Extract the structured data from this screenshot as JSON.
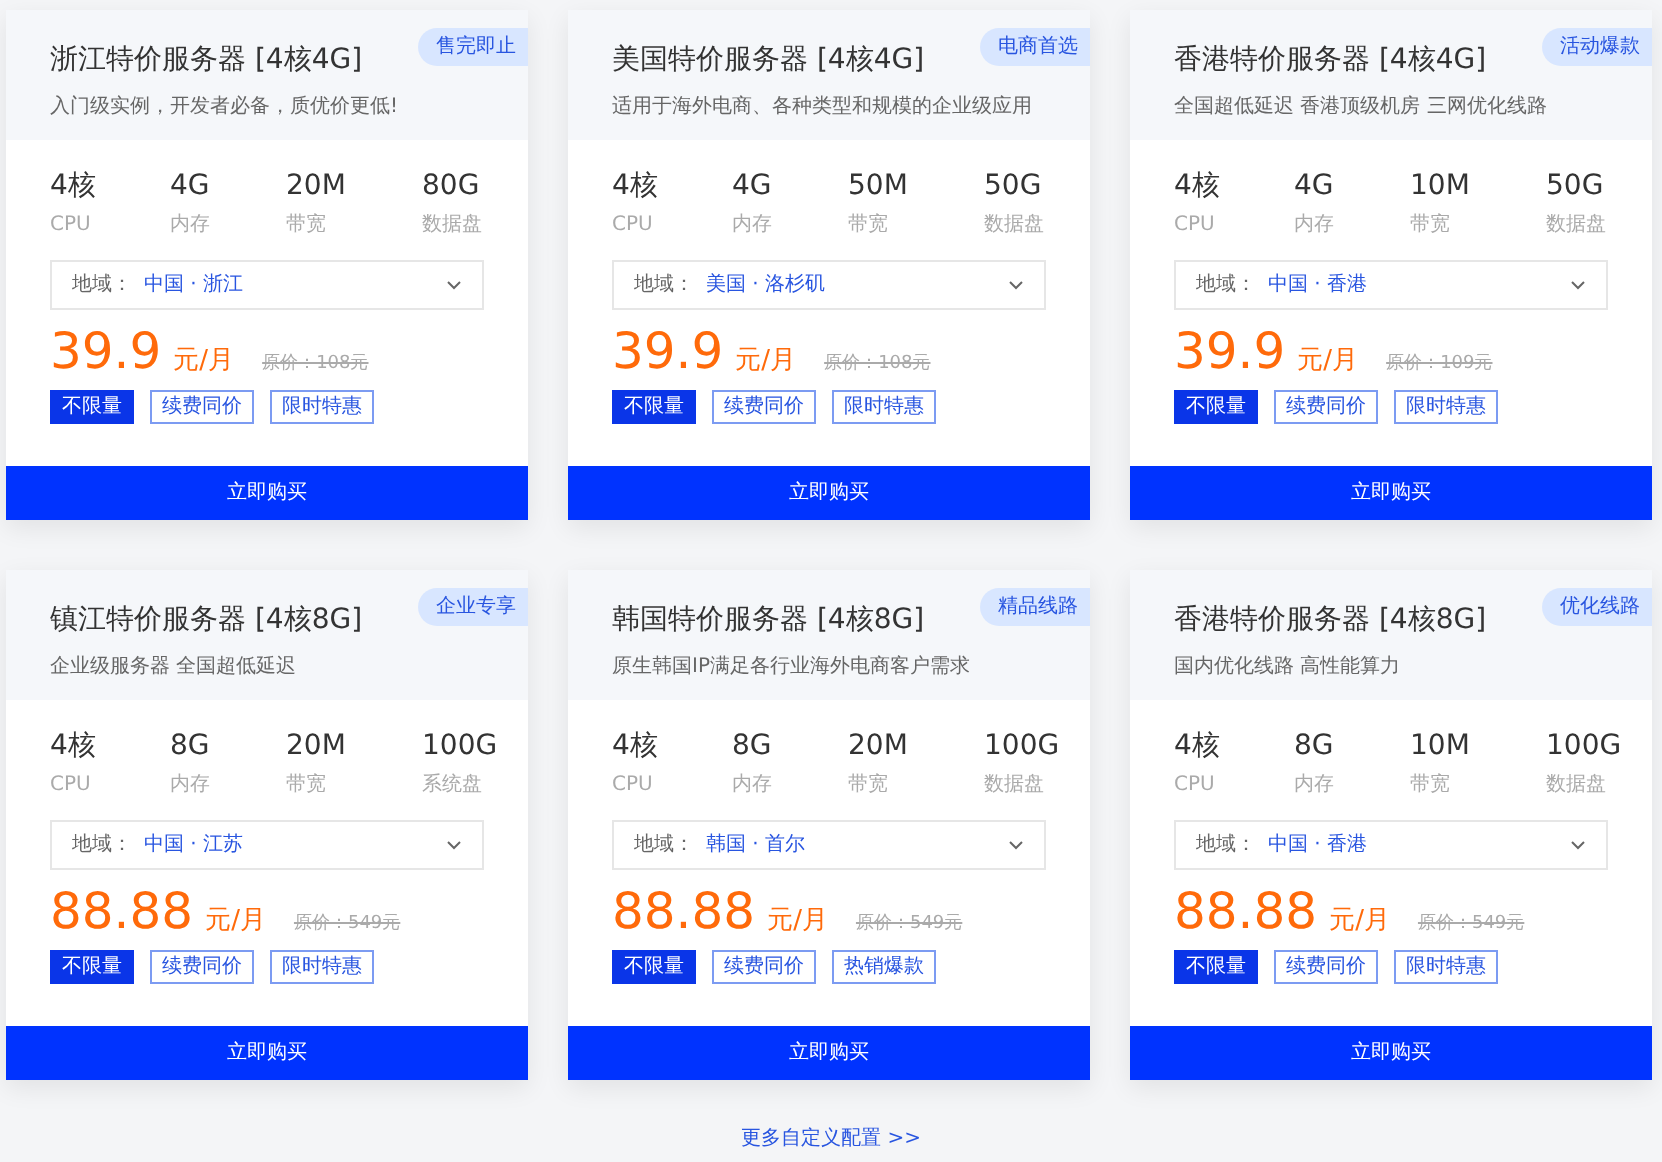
{
  "plans": [
    {
      "title": "浙江特价服务器 [4核4G]",
      "badge": "售完即止",
      "subtitle": "入门级实例，开发者必备，质优价更低!",
      "specs": [
        {
          "value": "4核",
          "label": "CPU"
        },
        {
          "value": "4G",
          "label": "内存"
        },
        {
          "value": "20M",
          "label": "带宽"
        },
        {
          "value": "80G",
          "label": "数据盘"
        }
      ],
      "region_label": "地域：",
      "region": "中国 · 浙江",
      "price": "39.9",
      "unit": "元/月",
      "original_price": "原价：108元",
      "tags": [
        {
          "text": "不限量",
          "kind": "solid"
        },
        {
          "text": "续费同价",
          "kind": "outline"
        },
        {
          "text": "限时特惠",
          "kind": "outline"
        }
      ],
      "button": "立即购买"
    },
    {
      "title": "美国特价服务器 [4核4G]",
      "badge": "电商首选",
      "subtitle": "适用于海外电商、各种类型和规模的企业级应用",
      "specs": [
        {
          "value": "4核",
          "label": "CPU"
        },
        {
          "value": "4G",
          "label": "内存"
        },
        {
          "value": "50M",
          "label": "带宽"
        },
        {
          "value": "50G",
          "label": "数据盘"
        }
      ],
      "region_label": "地域：",
      "region": "美国 · 洛杉矶",
      "price": "39.9",
      "unit": "元/月",
      "original_price": "原价：108元",
      "tags": [
        {
          "text": "不限量",
          "kind": "solid"
        },
        {
          "text": "续费同价",
          "kind": "outline"
        },
        {
          "text": "限时特惠",
          "kind": "outline"
        }
      ],
      "button": "立即购买"
    },
    {
      "title": "香港特价服务器 [4核4G]",
      "badge": "活动爆款",
      "subtitle": "全国超低延迟 香港顶级机房 三网优化线路",
      "specs": [
        {
          "value": "4核",
          "label": "CPU"
        },
        {
          "value": "4G",
          "label": "内存"
        },
        {
          "value": "10M",
          "label": "带宽"
        },
        {
          "value": "50G",
          "label": "数据盘"
        }
      ],
      "region_label": "地域：",
      "region": "中国 · 香港",
      "price": "39.9",
      "unit": "元/月",
      "original_price": "原价：109元",
      "tags": [
        {
          "text": "不限量",
          "kind": "solid"
        },
        {
          "text": "续费同价",
          "kind": "outline"
        },
        {
          "text": "限时特惠",
          "kind": "outline"
        }
      ],
      "button": "立即购买"
    },
    {
      "title": "镇江特价服务器 [4核8G]",
      "badge": "企业专享",
      "subtitle": "企业级服务器 全国超低延迟",
      "specs": [
        {
          "value": "4核",
          "label": "CPU"
        },
        {
          "value": "8G",
          "label": "内存"
        },
        {
          "value": "20M",
          "label": "带宽"
        },
        {
          "value": "100G",
          "label": "系统盘"
        }
      ],
      "region_label": "地域：",
      "region": "中国 · 江苏",
      "price": "88.88",
      "unit": "元/月",
      "original_price": "原价：549元",
      "tags": [
        {
          "text": "不限量",
          "kind": "solid"
        },
        {
          "text": "续费同价",
          "kind": "outline"
        },
        {
          "text": "限时特惠",
          "kind": "outline"
        }
      ],
      "button": "立即购买"
    },
    {
      "title": "韩国特价服务器 [4核8G]",
      "badge": "精品线路",
      "subtitle": "原生韩国IP满足各行业海外电商客户需求",
      "specs": [
        {
          "value": "4核",
          "label": "CPU"
        },
        {
          "value": "8G",
          "label": "内存"
        },
        {
          "value": "20M",
          "label": "带宽"
        },
        {
          "value": "100G",
          "label": "数据盘"
        }
      ],
      "region_label": "地域：",
      "region": "韩国 · 首尔",
      "price": "88.88",
      "unit": "元/月",
      "original_price": "原价：549元",
      "tags": [
        {
          "text": "不限量",
          "kind": "solid"
        },
        {
          "text": "续费同价",
          "kind": "outline"
        },
        {
          "text": "热销爆款",
          "kind": "outline"
        }
      ],
      "button": "立即购买"
    },
    {
      "title": "香港特价服务器 [4核8G]",
      "badge": "优化线路",
      "subtitle": "国内优化线路 高性能算力",
      "specs": [
        {
          "value": "4核",
          "label": "CPU"
        },
        {
          "value": "8G",
          "label": "内存"
        },
        {
          "value": "10M",
          "label": "带宽"
        },
        {
          "value": "100G",
          "label": "数据盘"
        }
      ],
      "region_label": "地域：",
      "region": "中国 · 香港",
      "price": "88.88",
      "unit": "元/月",
      "original_price": "原价：549元",
      "tags": [
        {
          "text": "不限量",
          "kind": "solid"
        },
        {
          "text": "续费同价",
          "kind": "outline"
        },
        {
          "text": "限时特惠",
          "kind": "outline"
        }
      ],
      "button": "立即购买"
    }
  ],
  "more_link": "更多自定义配置 >>"
}
